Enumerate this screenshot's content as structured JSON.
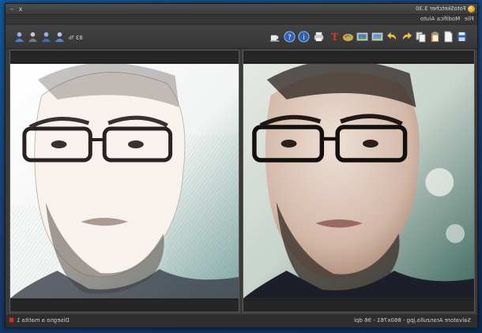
{
  "window": {
    "title": "FotoSketcher 3.30",
    "minimize": "–",
    "close": "x"
  },
  "menu": {
    "items": [
      "File",
      "Modifica",
      "Aiuto"
    ]
  },
  "toolbar": {
    "zoom": "83 %",
    "left_icons": [
      "person-icon",
      "person-icon",
      "person-icon",
      "person-icon"
    ],
    "right_icons": [
      "coffee-icon",
      "help-icon",
      "info-icon",
      "printer-icon",
      "text-icon",
      "palette-icon",
      "image-icon",
      "image-icon",
      "undo-icon",
      "redo-icon",
      "copy-icon",
      "paste-icon",
      "document-icon",
      "save-icon",
      "open-icon"
    ]
  },
  "status": {
    "left": "Disegno a matita 1",
    "right": "Salvatore Aranzulla.jpg - 860x761 - 96 dpi"
  },
  "colors": {
    "accent": "#1e6fb8",
    "status_square": "#c0392b"
  }
}
